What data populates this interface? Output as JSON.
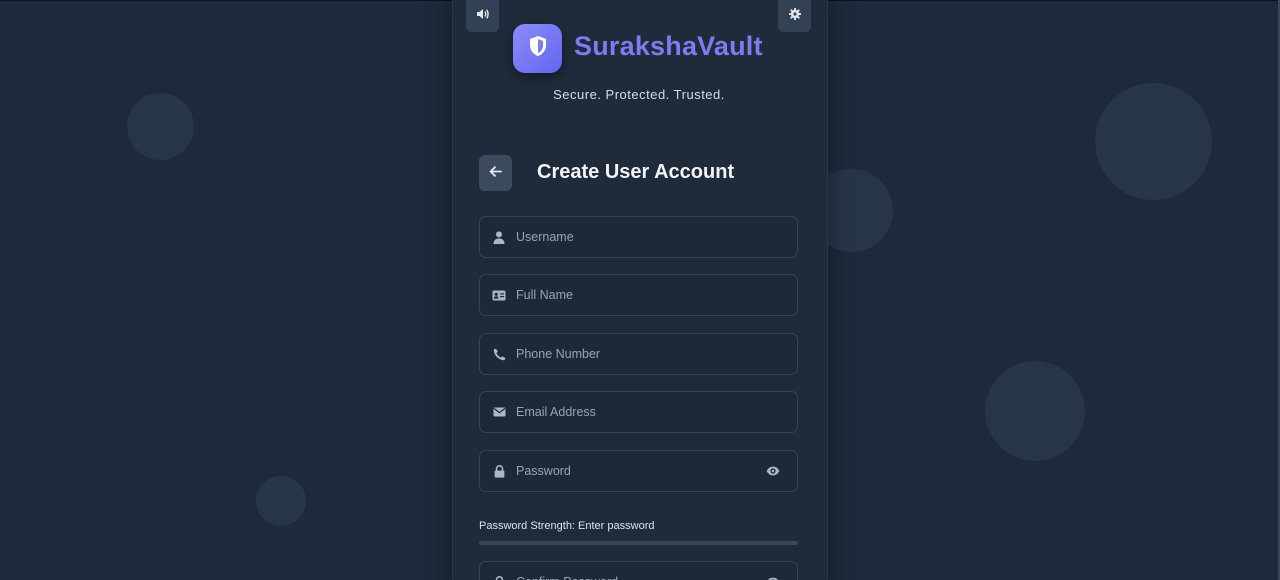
{
  "app": {
    "name": "SurakshaVault",
    "tagline": "Secure. Protected. Trusted."
  },
  "header": {
    "sound_icon": "speaker-icon",
    "settings_icon": "gear-icon",
    "logo_icon": "shield-icon"
  },
  "form": {
    "title": "Create User Account",
    "back_icon": "arrow-left-icon",
    "fields": {
      "username": {
        "placeholder": "Username",
        "icon": "user-icon",
        "value": ""
      },
      "full_name": {
        "placeholder": "Full Name",
        "icon": "id-card-icon",
        "value": ""
      },
      "phone": {
        "placeholder": "Phone Number",
        "icon": "phone-icon",
        "value": ""
      },
      "email": {
        "placeholder": "Email Address",
        "icon": "envelope-icon",
        "value": ""
      },
      "password": {
        "placeholder": "Password",
        "icon": "lock-icon",
        "toggle_icon": "eye-icon",
        "value": ""
      },
      "confirm_password": {
        "placeholder": "Confirm Password",
        "icon": "lock-icon",
        "toggle_icon": "eye-icon",
        "value": ""
      }
    },
    "password_strength": {
      "label": "Password Strength: Enter password",
      "level": 0
    }
  },
  "colors": {
    "background": "#1e293b",
    "card": "#1f2a3b",
    "accent": "#6366f1",
    "title": "#7c7cf0"
  }
}
